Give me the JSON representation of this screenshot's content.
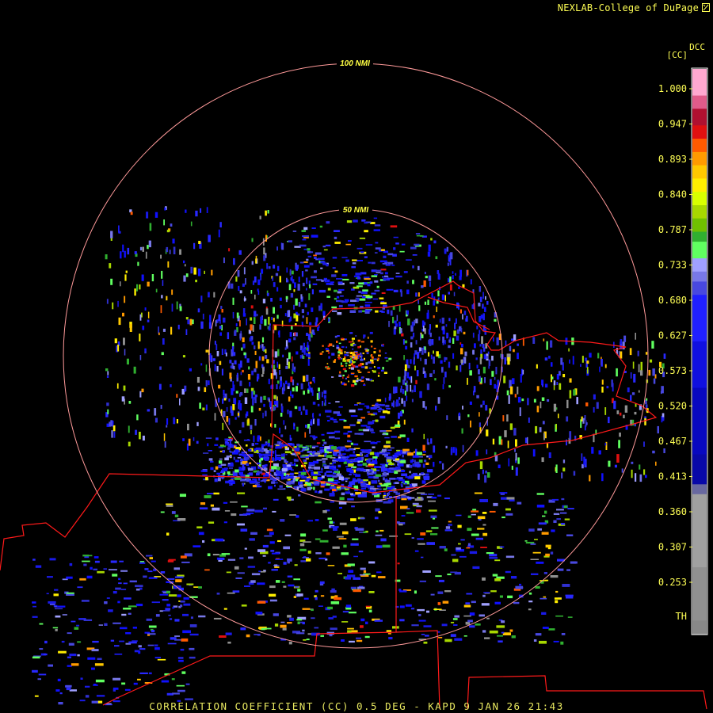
{
  "header": {
    "credit": "NEXLAB-College of DuPage",
    "logo_icon": "nexlab-logo-icon"
  },
  "product": {
    "caption": "CORRELATION COEFFICIENT (CC) 0.5 DEG - KAPD 9 JAN 26 21:43"
  },
  "range_rings": [
    {
      "label": "100 NMI",
      "range_nmi": 100
    },
    {
      "label": "50 NMI",
      "range_nmi": 50
    }
  ],
  "colorbar": {
    "product_code": "DCC",
    "unit_label": "[CC]",
    "ticks": [
      "1.000",
      "0.947",
      "0.893",
      "0.840",
      "0.787",
      "0.733",
      "0.680",
      "0.627",
      "0.573",
      "0.520",
      "0.467",
      "0.413",
      "0.360",
      "0.307",
      "0.253",
      "TH"
    ],
    "stops": [
      {
        "value": 1.05,
        "color": "#ffa8d0"
      },
      {
        "value": 1.01,
        "color": "#e05b8a"
      },
      {
        "value": 0.99,
        "color": "#b01030"
      },
      {
        "value": 0.965,
        "color": "#e01010"
      },
      {
        "value": 0.945,
        "color": "#ff5a00"
      },
      {
        "value": 0.925,
        "color": "#ff9a00"
      },
      {
        "value": 0.905,
        "color": "#ffc800"
      },
      {
        "value": 0.885,
        "color": "#ffee00"
      },
      {
        "value": 0.865,
        "color": "#d8ff00"
      },
      {
        "value": 0.845,
        "color": "#a8d800"
      },
      {
        "value": 0.825,
        "color": "#70c000"
      },
      {
        "value": 0.805,
        "color": "#30b030"
      },
      {
        "value": 0.79,
        "color": "#60ff60"
      },
      {
        "value": 0.765,
        "color": "#a0a0ff"
      },
      {
        "value": 0.745,
        "color": "#7878e8"
      },
      {
        "value": 0.73,
        "color": "#4848e0"
      },
      {
        "value": 0.71,
        "color": "#2020ff"
      },
      {
        "value": 0.64,
        "color": "#1010e0"
      },
      {
        "value": 0.57,
        "color": "#0808c0"
      },
      {
        "value": 0.47,
        "color": "#0808a8"
      },
      {
        "value": 0.425,
        "color": "#6868a0"
      },
      {
        "value": 0.41,
        "color": "#a0a0a0"
      },
      {
        "value": 0.3,
        "color": "#909090"
      },
      {
        "value": 0.22,
        "color": "#888888"
      },
      {
        "value": 0.2,
        "color": "#000000"
      }
    ]
  },
  "map": {
    "radar_site": "KAPD",
    "background": "#000000",
    "ring_color": "#ff9a9a",
    "boundary_color": "#ff1a1a"
  }
}
